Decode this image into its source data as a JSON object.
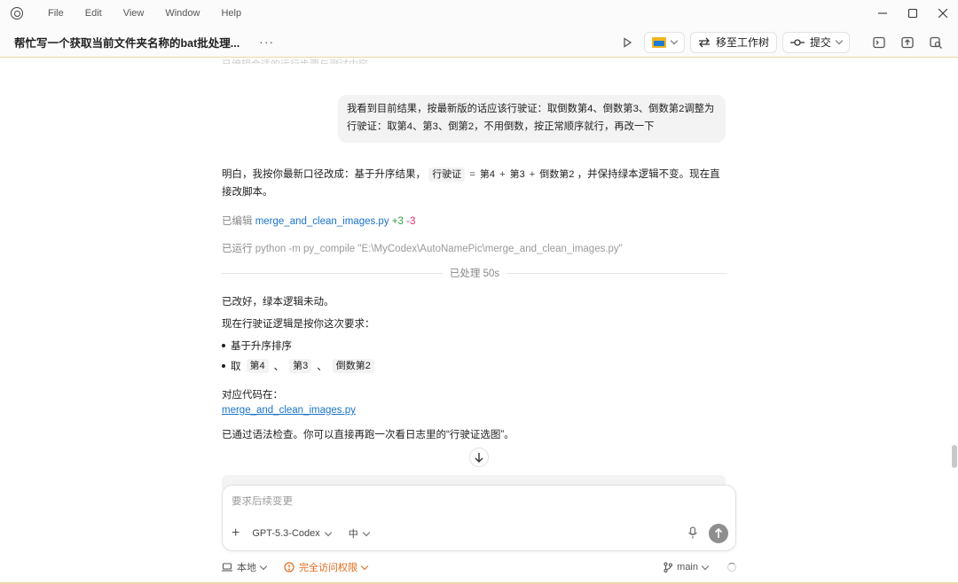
{
  "menu": [
    "File",
    "Edit",
    "View",
    "Window",
    "Help"
  ],
  "header": {
    "title": "帮忙写一个获取当前文件夹名称的bat批处理...",
    "more": "···",
    "move_label": "移至工作树",
    "commit_label": "提交"
  },
  "faded_text": "已编辑合适的运行步骤与测试内容",
  "user_message": "我看到目前结果，按最新版的话应该行驶证：取倒数第4、倒数第3、倒数第2调整为行驶证：取第4、第3、倒第2，不用倒数，按正常顺序就行，再改一下",
  "assistant": {
    "intro_a": "明白，我按你最新口径改成：基于升序结果，",
    "code_a": "行驶证",
    "eq": "=",
    "code_b": "第4",
    "plus1": "+",
    "code_c": "第3",
    "plus2": "+",
    "code_d": "倒数第2",
    "intro_b": "，并保持绿本逻辑不变。现在直接改脚本。",
    "edited_prefix": "已编辑",
    "edited_file": "merge_and_clean_images.py",
    "edited_add": "+3",
    "edited_del": "-3",
    "ran_prefix": "已运行",
    "ran_cmd": "python -m py_compile \"E:\\MyCodex\\AutoNamePic\\merge_and_clean_images.py\"",
    "processed": "已处理 50s",
    "done": "已改好，绿本逻辑未动。",
    "rule_intro": "现在行驶证逻辑是按你这次要求：",
    "bullet1": "基于升序排序",
    "bullet2_prefix": "取",
    "b2_code1": "第4",
    "sep1": "、",
    "b2_code2": "第3",
    "sep2": "、",
    "b2_code3": "倒数第2",
    "code_at": "对应代码在：",
    "code_link": "merge_and_clean_images.py",
    "final": "已通过语法检查。你可以直接再跑一次看日志里的“行驶证选图”。"
  },
  "composer": {
    "placeholder": "要求后续变更",
    "model": "GPT-5.3-Codex",
    "effort": "中"
  },
  "footer": {
    "local": "本地",
    "access": "完全访问权限",
    "branch": "main"
  },
  "colors": {
    "link": "#1a73c9",
    "added": "#2f9e44",
    "deleted": "#d6336c",
    "warning": "#e06a1a"
  }
}
